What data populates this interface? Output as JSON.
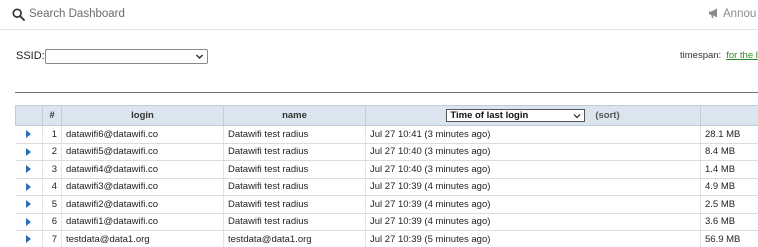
{
  "search": {
    "placeholder": "Search Dashboard"
  },
  "header": {
    "announcements_label": "Annou"
  },
  "filter": {
    "ssid_label": "SSID:",
    "ssid_value": ""
  },
  "timespan": {
    "label": "timespan:",
    "link_text": "for the l"
  },
  "table": {
    "headers": {
      "expand": "",
      "num": "#",
      "login": "login",
      "name": "name",
      "sort_select": "Time of last login",
      "sort_label": "(sort)",
      "usage": ""
    },
    "rows": [
      {
        "num": "1",
        "login": "datawifi6@datawifi.co",
        "name": "Datawifi test radius",
        "last_login": "Jul 27 10:41 (3 minutes ago)",
        "usage": "28.1 MB"
      },
      {
        "num": "2",
        "login": "datawifi5@datawifi.co",
        "name": "Datawifi test radius",
        "last_login": "Jul 27 10:40 (3 minutes ago)",
        "usage": "8.4 MB"
      },
      {
        "num": "3",
        "login": "datawifi4@datawifi.co",
        "name": "Datawifi test radius",
        "last_login": "Jul 27 10:40 (3 minutes ago)",
        "usage": "1.4 MB"
      },
      {
        "num": "4",
        "login": "datawifi3@datawifi.co",
        "name": "Datawifi test radius",
        "last_login": "Jul 27 10:39 (4 minutes ago)",
        "usage": "4.9 MB"
      },
      {
        "num": "5",
        "login": "datawifi2@datawifi.co",
        "name": "Datawifi test radius",
        "last_login": "Jul 27 10:39 (4 minutes ago)",
        "usage": "2.5 MB"
      },
      {
        "num": "6",
        "login": "datawifi1@datawifi.co",
        "name": "Datawifi test radius",
        "last_login": "Jul 27 10:39 (4 minutes ago)",
        "usage": "3.6 MB"
      },
      {
        "num": "7",
        "login": "testdata@data1.org",
        "name": "testdata@data1.org",
        "last_login": "Jul 27 10:39 (5 minutes ago)",
        "usage": "56.9 MB"
      }
    ]
  },
  "colors": {
    "header_bg": "#dbe5ef",
    "link": "#2a8a2a",
    "expand_arrow": "#2a6db5"
  },
  "icons": {
    "search": "search-icon",
    "announce": "megaphone-icon",
    "expand": "expand-arrow-icon",
    "dropdown": "chevron-down-icon"
  }
}
